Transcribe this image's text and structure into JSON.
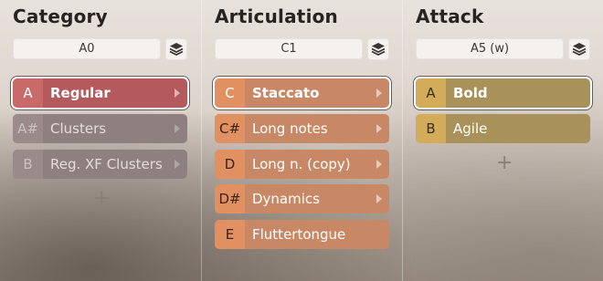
{
  "columns": [
    {
      "title": "Category",
      "key_value": "A0",
      "items": [
        {
          "key": "A",
          "label": "Regular"
        },
        {
          "key": "A#",
          "label": "Clusters"
        },
        {
          "key": "B",
          "label": "Reg. XF Clusters"
        }
      ]
    },
    {
      "title": "Articulation",
      "key_value": "C1",
      "items": [
        {
          "key": "C",
          "label": "Staccato"
        },
        {
          "key": "C#",
          "label": "Long notes"
        },
        {
          "key": "D",
          "label": "Long n. (copy)"
        },
        {
          "key": "D#",
          "label": "Dynamics"
        },
        {
          "key": "E",
          "label": "Fluttertongue"
        }
      ]
    },
    {
      "title": "Attack",
      "key_value": "A5 (w)",
      "items": [
        {
          "key": "A",
          "label": "Bold"
        },
        {
          "key": "B",
          "label": "Agile"
        }
      ]
    }
  ],
  "icons": {
    "stack": "layers-icon",
    "add": "plus-icon",
    "submenu": "chevron-right-icon"
  },
  "plus_symbol": "+",
  "colors": {
    "category_active": "#b45a5d",
    "category_inactive": "#8e7f80",
    "articulation": "#c98865",
    "attack": "#a8925a"
  }
}
